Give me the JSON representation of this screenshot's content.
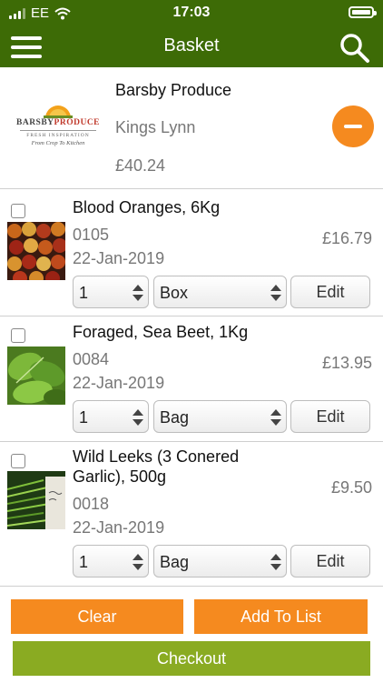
{
  "status_bar": {
    "carrier": "EE",
    "time": "17:03"
  },
  "nav": {
    "title": "Basket",
    "menu_icon": "hamburger-menu-icon",
    "search_icon": "search-icon"
  },
  "supplier": {
    "logo": {
      "brand_part1": "BARSBY",
      "brand_part2": "PRODUCE",
      "tagline_top": "FRESH INSPIRATION",
      "tagline_bottom": "From Crop To Kitchen"
    },
    "name": "Barsby Produce",
    "location": "Kings Lynn",
    "total": "£40.24",
    "remove_icon": "minus-circle-icon"
  },
  "items": [
    {
      "name": "Blood Oranges, 6Kg",
      "code": "0105",
      "date": "22-Jan-2019",
      "price": "£16.79",
      "quantity": "1",
      "unit": "Box",
      "edit_label": "Edit",
      "image": "blood-oranges-photo"
    },
    {
      "name": "Foraged, Sea Beet, 1Kg",
      "code": "0084",
      "date": "22-Jan-2019",
      "price": "£13.95",
      "quantity": "1",
      "unit": "Bag",
      "edit_label": "Edit",
      "image": "sea-beet-photo"
    },
    {
      "name": "Wild Leeks (3 Conered Garlic), 500g",
      "code": "0018",
      "date": "22-Jan-2019",
      "price": "£9.50",
      "quantity": "1",
      "unit": "Bag",
      "edit_label": "Edit",
      "image": "wild-leeks-photo"
    }
  ],
  "actions": {
    "clear_label": "Clear",
    "add_to_list_label": "Add To List",
    "checkout_label": "Checkout"
  },
  "colors": {
    "header_green": "#3d6b06",
    "orange": "#f58a1f",
    "checkout_green": "#8aab22"
  }
}
